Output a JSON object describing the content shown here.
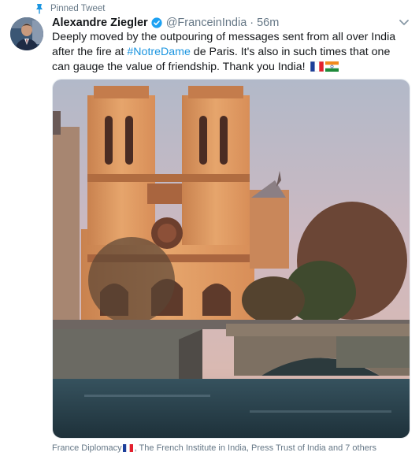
{
  "pinned": {
    "label": "Pinned Tweet",
    "icon": "pin-icon"
  },
  "author": {
    "name": "Alexandre Ziegler",
    "handle": "@FranceinIndia",
    "separator": "·",
    "time": "56m",
    "verified": true
  },
  "tweet": {
    "text_before": "Deeply moved by the outpouring of messages sent from all over India after the fire at ",
    "hashtag": "#NotreDame",
    "text_after": " de Paris. It's also in such times that one can gauge the value of friendship. Thank you India! ",
    "emoji": [
      "france-flag",
      "india-flag"
    ]
  },
  "media": {
    "alt_subject": "notre-dame-cathedral-photo"
  },
  "footer": {
    "part1": "France Diplomacy",
    "part2": ", The French Institute in India, Press Trust of India and 7 others"
  },
  "colors": {
    "accent": "#1b95e0",
    "muted": "#657786",
    "text": "#14171a"
  }
}
